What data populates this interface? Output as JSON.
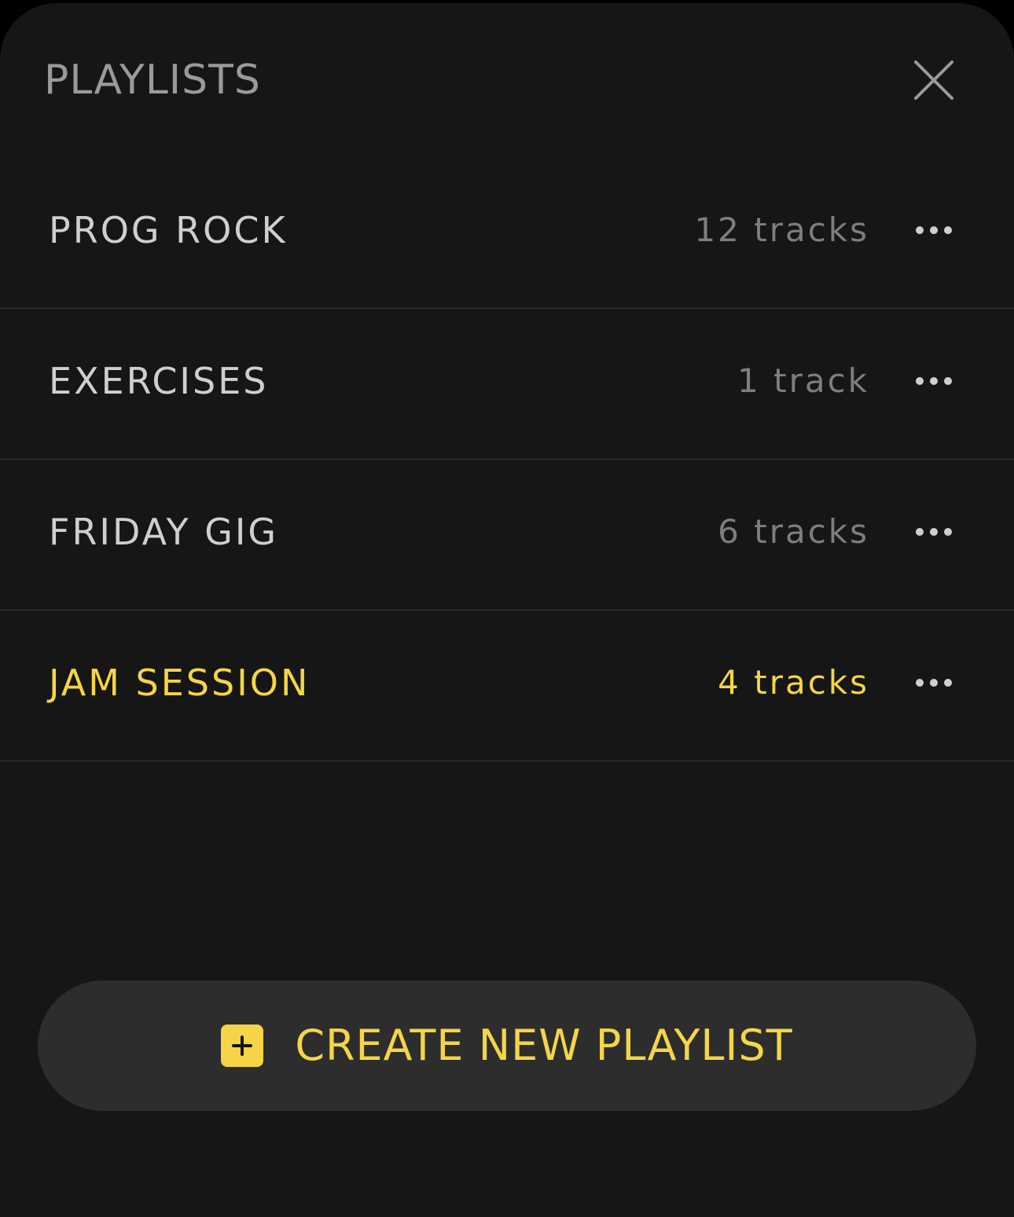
{
  "header": {
    "title": "PLAYLISTS",
    "close_icon": "close-icon"
  },
  "playlists": [
    {
      "name": "PROG ROCK",
      "count": "12 tracks",
      "active": false
    },
    {
      "name": "EXERCISES",
      "count": "1 track",
      "active": false
    },
    {
      "name": "FRIDAY GIG",
      "count": "6 tracks",
      "active": false
    },
    {
      "name": "JAM SESSION",
      "count": "4 tracks",
      "active": true
    }
  ],
  "more_icon": "more-horizontal-icon",
  "create_button": {
    "label": "CREATE NEW PLAYLIST",
    "icon": "plus-square-icon"
  },
  "colors": {
    "background": "#161616",
    "accent": "#f5d547",
    "text": "#cfcfcf",
    "muted": "#7e7e7e",
    "button_bg": "#2d2d2d"
  }
}
